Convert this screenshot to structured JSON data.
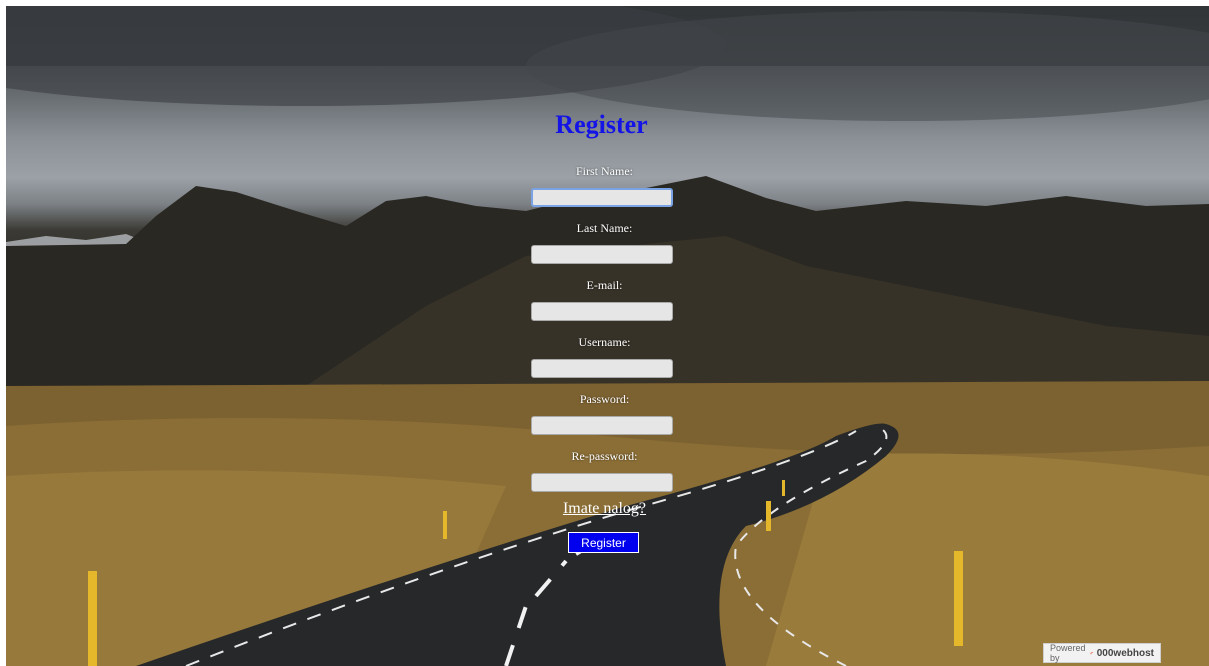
{
  "form": {
    "title": "Register",
    "fields": [
      {
        "label": "First Name:",
        "value": ""
      },
      {
        "label": "Last Name:",
        "value": ""
      },
      {
        "label": "E-mail:",
        "value": ""
      },
      {
        "label": "Username:",
        "value": ""
      },
      {
        "label": "Password:",
        "value": ""
      },
      {
        "label": "Re-password:",
        "value": ""
      }
    ],
    "login_link": "Imate nalog?",
    "submit_label": "Register"
  },
  "footer": {
    "powered_by": "Powered by",
    "brand": "000webhost"
  },
  "colors": {
    "title": "#1414e6",
    "button_bg": "#0000ee",
    "input_bg": "#e6e6e6"
  }
}
